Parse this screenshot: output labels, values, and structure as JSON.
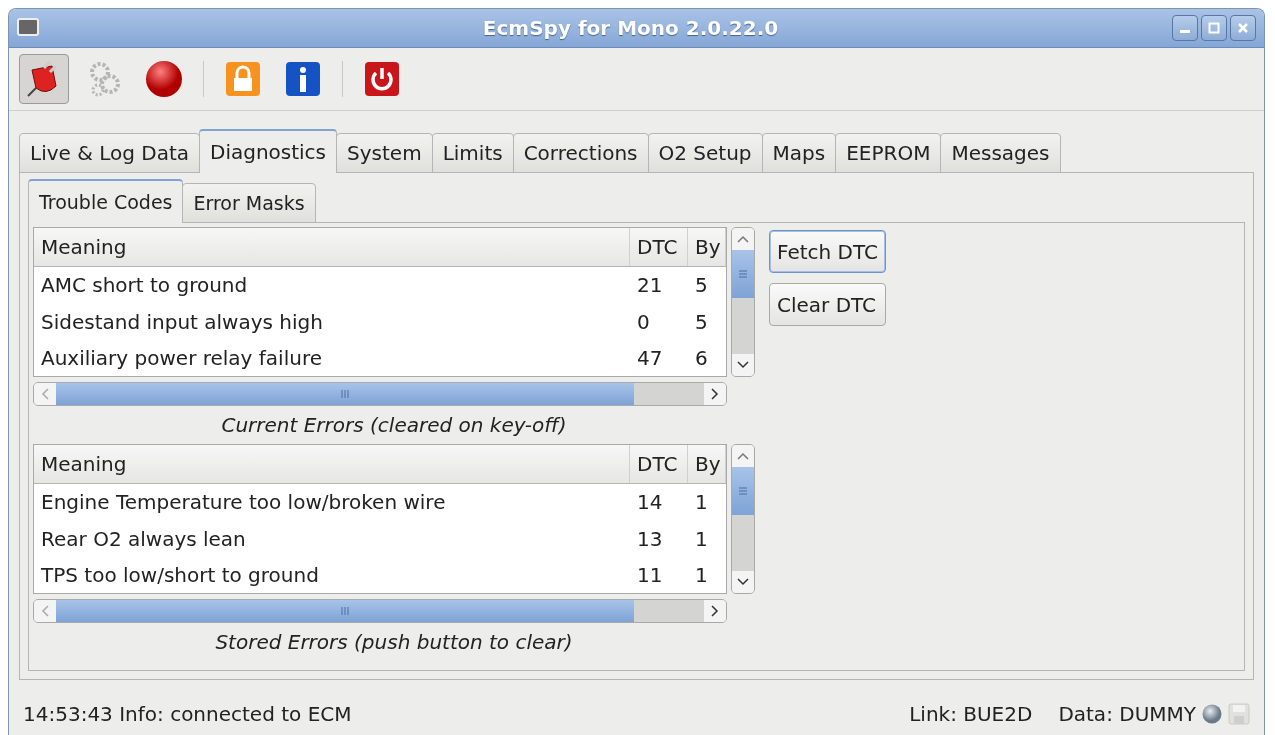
{
  "window": {
    "title": "EcmSpy for Mono 2.0.22.0"
  },
  "toolbar": [
    {
      "kind": "connect",
      "pressed": true,
      "disabled": false
    },
    {
      "kind": "settings",
      "pressed": false,
      "disabled": true
    },
    {
      "kind": "record",
      "pressed": false,
      "disabled": false
    },
    {
      "kind": "separator"
    },
    {
      "kind": "lock",
      "pressed": false,
      "disabled": false
    },
    {
      "kind": "info",
      "pressed": false,
      "disabled": false
    },
    {
      "kind": "separator"
    },
    {
      "kind": "power",
      "pressed": false,
      "disabled": false
    }
  ],
  "tabs": [
    {
      "label": "Live & Log Data",
      "selected": false
    },
    {
      "label": "Diagnostics",
      "selected": true
    },
    {
      "label": "System",
      "selected": false
    },
    {
      "label": "Limits",
      "selected": false
    },
    {
      "label": "Corrections",
      "selected": false
    },
    {
      "label": "O2 Setup",
      "selected": false
    },
    {
      "label": "Maps",
      "selected": false
    },
    {
      "label": "EEPROM",
      "selected": false
    },
    {
      "label": "Messages",
      "selected": false
    }
  ],
  "subtabs": [
    {
      "label": "Trouble Codes",
      "selected": true
    },
    {
      "label": "Error Masks",
      "selected": false
    }
  ],
  "tables": [
    {
      "columns": [
        "Meaning",
        "DTC",
        "By"
      ],
      "rows": [
        [
          "AMC short to ground",
          "21",
          "5"
        ],
        [
          "Sidestand input always high",
          "0",
          "5"
        ],
        [
          "Auxiliary power relay failure",
          "47",
          "6"
        ]
      ],
      "caption": "Current Errors (cleared on key-off)"
    },
    {
      "columns": [
        "Meaning",
        "DTC",
        "By"
      ],
      "rows": [
        [
          "Engine Temperature too low/broken wire",
          "14",
          "1"
        ],
        [
          "Rear O2 always lean",
          "13",
          "1"
        ],
        [
          "TPS too low/short to ground",
          "11",
          "1"
        ]
      ],
      "caption": "Stored Errors (push button to clear)"
    }
  ],
  "buttons": [
    {
      "label": "Fetch DTC",
      "focused": true
    },
    {
      "label": "Clear DTC",
      "focused": false
    }
  ],
  "status_bar": {
    "message": "14:53:43 Info: connected to ECM",
    "link": "Link: BUE2D",
    "data": "Data: DUMMY",
    "save_disabled": true
  }
}
